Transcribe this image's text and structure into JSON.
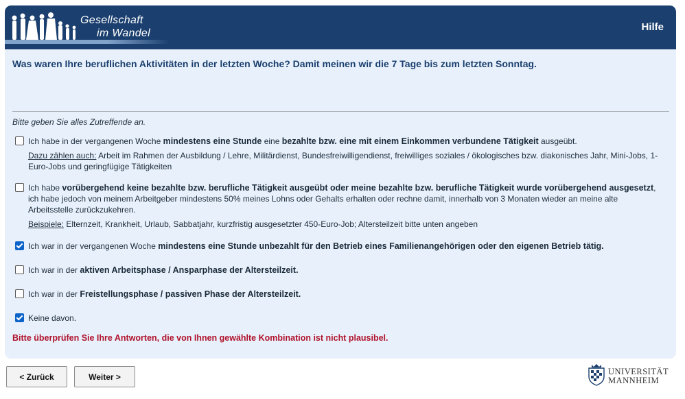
{
  "header": {
    "logo_line1": "Gesellschaft",
    "logo_line2": "im Wandel",
    "help_label": "Hilfe",
    "bg_color": "#1b3f6e"
  },
  "question": "Was waren Ihre beruflichen Aktivitäten in der letzten Woche? Damit meinen wir die 7 Tage bis zum letzten Sonntag.",
  "instruction": "Bitte geben Sie alles Zutreffende an.",
  "options": [
    {
      "checked": false,
      "t1": "Ich habe in der vergangenen Woche ",
      "b1": "mindestens eine Stunde",
      "t2": " eine ",
      "b2": "bezahlte bzw. eine mit einem Einkommen verbundene Tätigkeit",
      "t3": " ausgeübt.",
      "sub_label": "Dazu zählen auch:",
      "sub_text": " Arbeit im Rahmen der Ausbildung / Lehre, Militärdienst, Bundesfreiwilligendienst, freiwilliges soziales / ökologisches bzw. diakonisches Jahr, Mini-Jobs, 1-Euro-Jobs und geringfügige Tätigkeiten"
    },
    {
      "checked": false,
      "t1": "Ich habe ",
      "b1": "vorübergehend keine bezahlte bzw. berufliche Tätigkeit ausgeübt oder meine bezahlte bzw. berufliche Tätigkeit wurde vorübergehend ausgesetzt",
      "t2": ", ich habe jedoch von meinem Arbeitgeber mindestens 50% meines Lohns oder Gehalts erhalten oder rechne damit, innerhalb von 3 Monaten wieder an meine alte Arbeitsstelle zurückzukehren.",
      "sub_label": "Beispiele:",
      "sub_text": " Elternzeit, Krankheit, Urlaub, Sabbatjahr, kurzfristig ausgesetzter 450-Euro-Job; Altersteilzeit bitte unten angeben"
    },
    {
      "checked": true,
      "t1": "Ich war in der vergangenen Woche ",
      "b1": "mindestens eine Stunde unbezahlt für den Betrieb eines Familienangehörigen oder den eigenen Betrieb tätig."
    },
    {
      "checked": false,
      "t1": "Ich war in der ",
      "b1": "aktiven Arbeitsphase / Ansparphase der Altersteilzeit."
    },
    {
      "checked": false,
      "t1": "Ich war in der ",
      "b1": "Freistellungsphase / passiven Phase der Altersteilzeit."
    },
    {
      "checked": true,
      "t1": "Keine davon."
    }
  ],
  "error_message": "Bitte überprüfen Sie Ihre Antworten, die von Ihnen gewählte Kombination ist nicht plausibel.",
  "nav": {
    "back_label": "< Zurück",
    "next_label": "Weiter >"
  },
  "university": {
    "line1": "UNIVERSITÄT",
    "line2": "MANNHEIM"
  },
  "colors": {
    "accent": "#1b3f6e",
    "panel": "#e8f1fb",
    "error": "#b0122c",
    "checkbox": "#0b63c9"
  }
}
